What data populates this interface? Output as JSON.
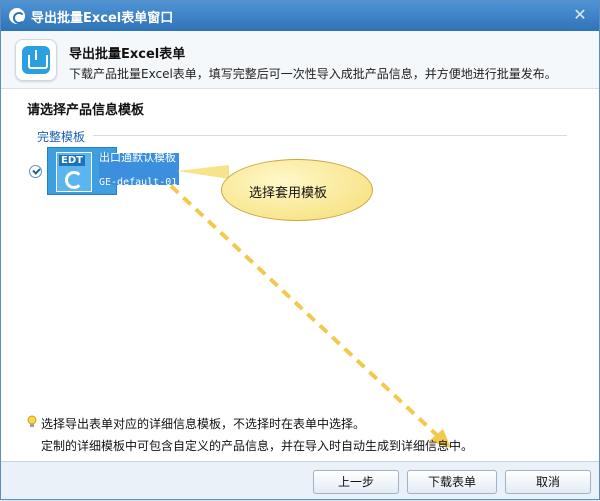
{
  "window": {
    "title": "导出批量Excel表单窗口"
  },
  "header": {
    "title": "导出批量Excel表单",
    "description": "下载产品批量Excel表单，填写完整后可一次性导入成批产品信息，并方便地进行批量发布。"
  },
  "section": {
    "title": "请选择产品信息模板"
  },
  "group": {
    "label": "完整模板"
  },
  "template": {
    "thumb_label": "EDT",
    "name": "出口通默认模板",
    "code": "GE-default-01"
  },
  "callout": {
    "text": "选择套用模板"
  },
  "hints": {
    "line1": "选择导出表单对应的详细信息模板，不选择时在表单中选择。",
    "line2": "定制的详细模板中可包含自定义的产品信息，并在导入时自动生成到详细信息中。"
  },
  "footer": {
    "prev_label": "上一步",
    "download_label": "下载表单",
    "cancel_label": "取消"
  },
  "colors": {
    "titlebar": "#2f73b8",
    "accent": "#1a62b5",
    "callout": "#f5dd73",
    "arrow": "#f2c94c"
  }
}
